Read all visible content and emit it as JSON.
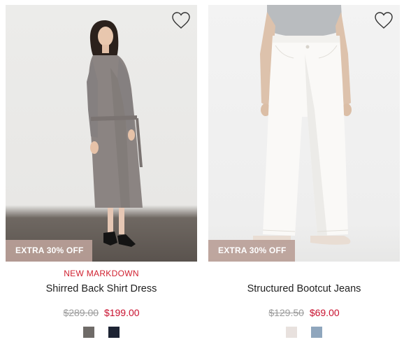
{
  "products": [
    {
      "promo": "EXTRA 30% OFF",
      "badge": "NEW MARKDOWN",
      "name": "Shirred Back Shirt Dress",
      "original_price": "$289.00",
      "sale_price": "$199.00",
      "wishlist_icon": "heart-outline-icon",
      "swatches": [
        {
          "color": "#6f6b68"
        },
        {
          "color": "#1d2333"
        }
      ]
    },
    {
      "promo": "EXTRA 30% OFF",
      "badge": "",
      "name": "Structured Bootcut Jeans",
      "original_price": "$129.50",
      "sale_price": "$69.00",
      "wishlist_icon": "heart-outline-icon",
      "swatches": [
        {
          "color": "#e8e1de"
        },
        {
          "color": "#8fa6bd"
        }
      ]
    }
  ],
  "colors": {
    "sale": "#c8102e",
    "badge": "#d0202f",
    "promo_bg": "#baa098",
    "strike": "#9a9a9a"
  }
}
